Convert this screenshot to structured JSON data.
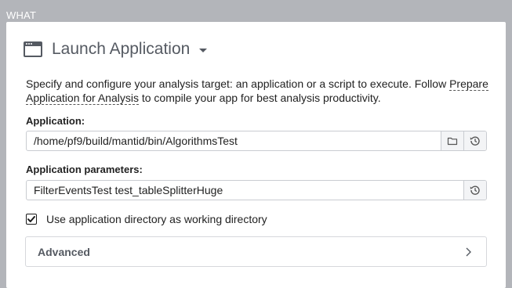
{
  "section": {
    "label": "WHAT"
  },
  "header": {
    "title": "Launch Application"
  },
  "description": {
    "prefix": "Specify and configure your analysis target: an application or a script to execute. Follow ",
    "link": "Prepare Application for Analysis",
    "suffix": " to compile your app for best analysis productivity."
  },
  "application": {
    "label": "Application:",
    "value": "/home/pf9/build/mantid/bin/AlgorithmsTest"
  },
  "parameters": {
    "label": "Application parameters:",
    "value": "FilterEventsTest test_tableSplitterHuge"
  },
  "working_dir": {
    "label": "Use application directory as working directory",
    "checked": true
  },
  "advanced": {
    "label": "Advanced"
  },
  "icons": {
    "app": "application-window-icon",
    "caret": "caret-down-icon",
    "browse": "folder-icon",
    "history": "history-icon",
    "check": "checkmark-icon",
    "expand": "chevron-right-icon"
  },
  "colors": {
    "background": "#b3b5ba",
    "panel": "#ffffff",
    "title": "#555a62",
    "border": "#c9ccd1"
  }
}
